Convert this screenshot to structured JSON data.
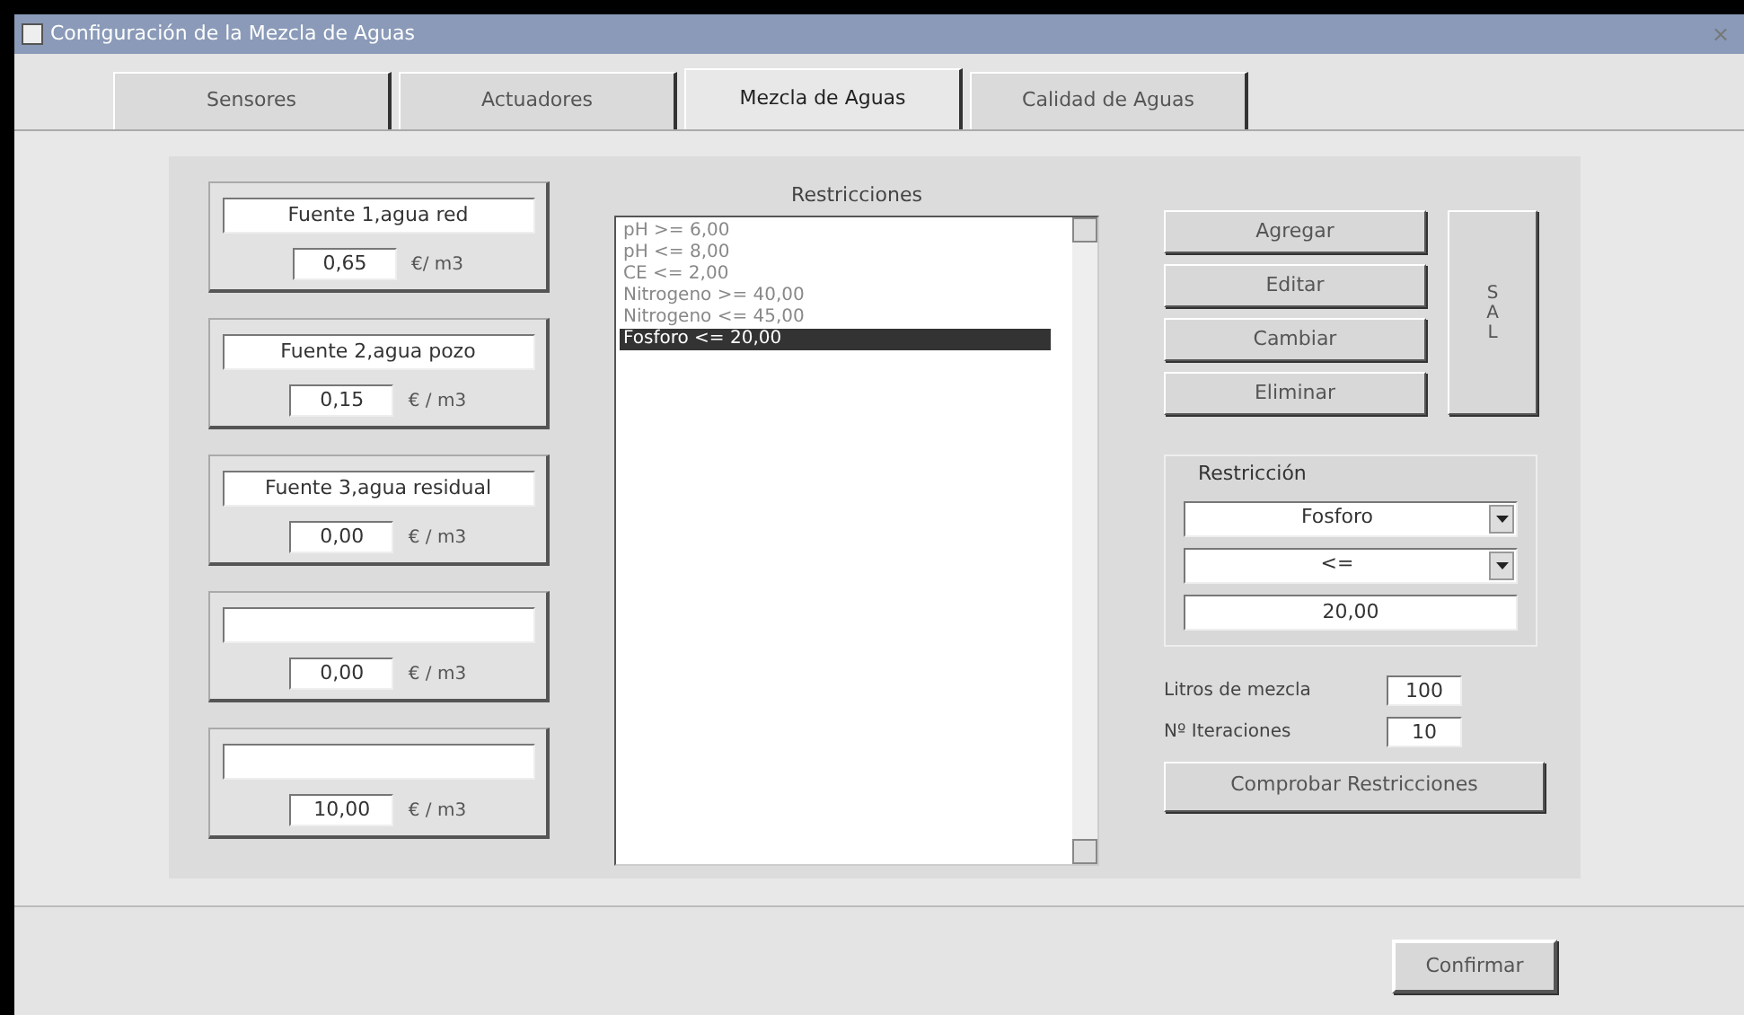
{
  "window": {
    "title": "Configuración de la Mezcla de Aguas",
    "close": "×"
  },
  "tabs": [
    {
      "label": "Sensores",
      "selected": false
    },
    {
      "label": "Actuadores",
      "selected": false
    },
    {
      "label": "Mezcla de Aguas",
      "selected": true
    },
    {
      "label": "Calidad de Aguas",
      "selected": false
    }
  ],
  "sources": [
    {
      "name": "Fuente 1,agua red",
      "price": "0,65",
      "unit": "€/ m3"
    },
    {
      "name": "Fuente 2,agua pozo",
      "price": "0,15",
      "unit": "€ / m3"
    },
    {
      "name": "Fuente 3,agua residual",
      "price": "0,00",
      "unit": "€ / m3"
    },
    {
      "price": "0,00",
      "unit": "€ / m3"
    },
    {
      "price": "10,00",
      "unit": "€ / m3"
    }
  ],
  "restrictions": {
    "title": "Restricciones",
    "items": [
      {
        "label": "pH >= 6,00",
        "selected": false
      },
      {
        "label": "pH <= 8,00",
        "selected": false
      },
      {
        "label": "CE <= 2,00",
        "selected": false
      },
      {
        "label": "Nitrogeno >= 40,00",
        "selected": false
      },
      {
        "label": "Nitrogeno <= 45,00",
        "selected": false
      },
      {
        "label": "Fosforo <= 20,00",
        "selected": true
      }
    ]
  },
  "buttons": [
    "Agregar",
    "Editar",
    "Cambiar",
    "Eliminar"
  ],
  "exit_button": "SAL",
  "restriction": {
    "title": "Restricción",
    "variable": "Fosforo",
    "operator": "<=",
    "value": "20,00"
  },
  "settings": [
    {
      "label": "Litros de mezcla",
      "value": "100"
    },
    {
      "label": "Nº Iteraciones",
      "value": "10"
    }
  ],
  "check_button": "Comprobar Restricciones",
  "confirm_button": "Confirmar"
}
